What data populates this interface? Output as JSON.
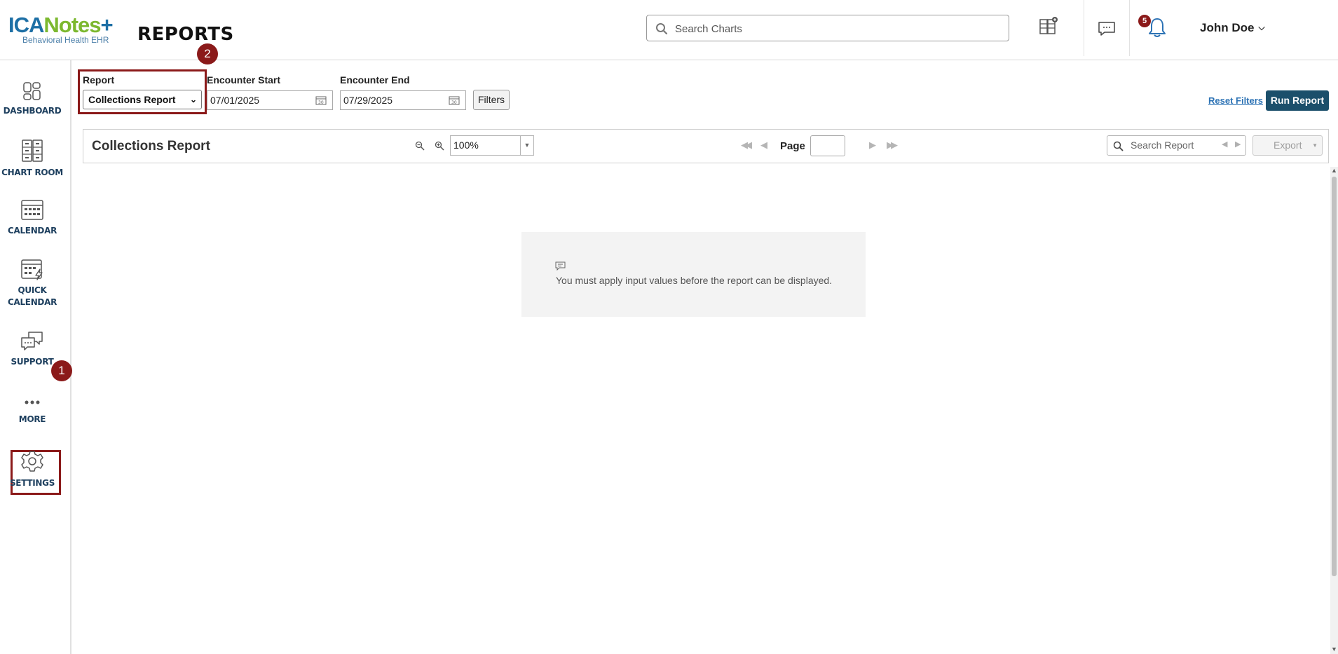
{
  "header": {
    "logo": {
      "brand_part1": "ICA",
      "brand_part2": "Notes",
      "brand_part3": "+",
      "subtitle": "Behavioral Health EHR"
    },
    "page_title": "REPORTS",
    "search": {
      "placeholder": "Search Charts",
      "value": ""
    },
    "notifications_count": "5",
    "user_name": "John Doe"
  },
  "sidebar": {
    "items": [
      {
        "label": "DASHBOARD",
        "icon": "dashboard-icon"
      },
      {
        "label": "CHART ROOM",
        "icon": "chart-room-icon"
      },
      {
        "label": "CALENDAR",
        "icon": "calendar-icon"
      },
      {
        "label": "QUICK",
        "label2": "CALENDAR",
        "icon": "quick-calendar-icon"
      },
      {
        "label": "SUPPORT",
        "icon": "support-icon"
      },
      {
        "label": "MORE",
        "icon": "more-icon"
      },
      {
        "label": "SETTINGS",
        "icon": "settings-icon"
      }
    ]
  },
  "annotations": {
    "step1": "1",
    "step2": "2",
    "highlight_color": "#8b1a1a"
  },
  "filters": {
    "report_label": "Report",
    "report_selected": "Collections Report",
    "encounter_start_label": "Encounter Start",
    "encounter_start_value": "07/01/2025",
    "encounter_end_label": "Encounter End",
    "encounter_end_value": "07/29/2025",
    "filters_button": "Filters",
    "reset_filters": "Reset Filters",
    "run_report": "Run Report"
  },
  "viewer": {
    "title": "Collections Report",
    "zoom": "100%",
    "page_label": "Page",
    "page_value": "",
    "search_placeholder": "Search Report",
    "export_label": "Export",
    "message": "You must apply input values before the report can be displayed."
  },
  "colors": {
    "primary_button": "#1b4f6b",
    "link": "#2d73b5",
    "nav_text": "#1d3f5e"
  }
}
